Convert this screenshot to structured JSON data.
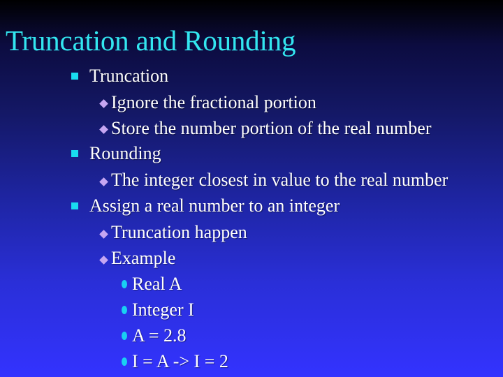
{
  "slide": {
    "title": "Truncation and Rounding",
    "accent_colors": {
      "title": "#33e6f0",
      "level1_bullet": "#19dcf0",
      "level2_bullet": "#c6a6f2",
      "level3_bullet": "#19d0f2",
      "background_top": "#000000",
      "background_bottom": "#3333ff"
    },
    "bullets": [
      {
        "text": "Truncation",
        "icon": "square-bullet-icon",
        "children": [
          {
            "text": "Ignore the fractional portion",
            "icon": "diamond-bullet-icon"
          },
          {
            "text": "Store the number portion of the real number",
            "icon": "diamond-bullet-icon"
          }
        ]
      },
      {
        "text": "Rounding",
        "icon": "square-bullet-icon",
        "children": [
          {
            "text": "The integer closest in value to the real number",
            "icon": "diamond-bullet-icon"
          }
        ]
      },
      {
        "text": "Assign a real number to an integer",
        "icon": "square-bullet-icon",
        "children": [
          {
            "text": "Truncation happen",
            "icon": "diamond-bullet-icon"
          },
          {
            "text": "Example",
            "icon": "diamond-bullet-icon",
            "children": [
              {
                "text": "Real A",
                "icon": "drop-bullet-icon"
              },
              {
                "text": "Integer I",
                "icon": "drop-bullet-icon"
              },
              {
                "text": "A = 2.8",
                "icon": "drop-bullet-icon"
              },
              {
                "text": "I = A -> I = 2",
                "icon": "drop-bullet-icon"
              }
            ]
          }
        ]
      }
    ]
  }
}
